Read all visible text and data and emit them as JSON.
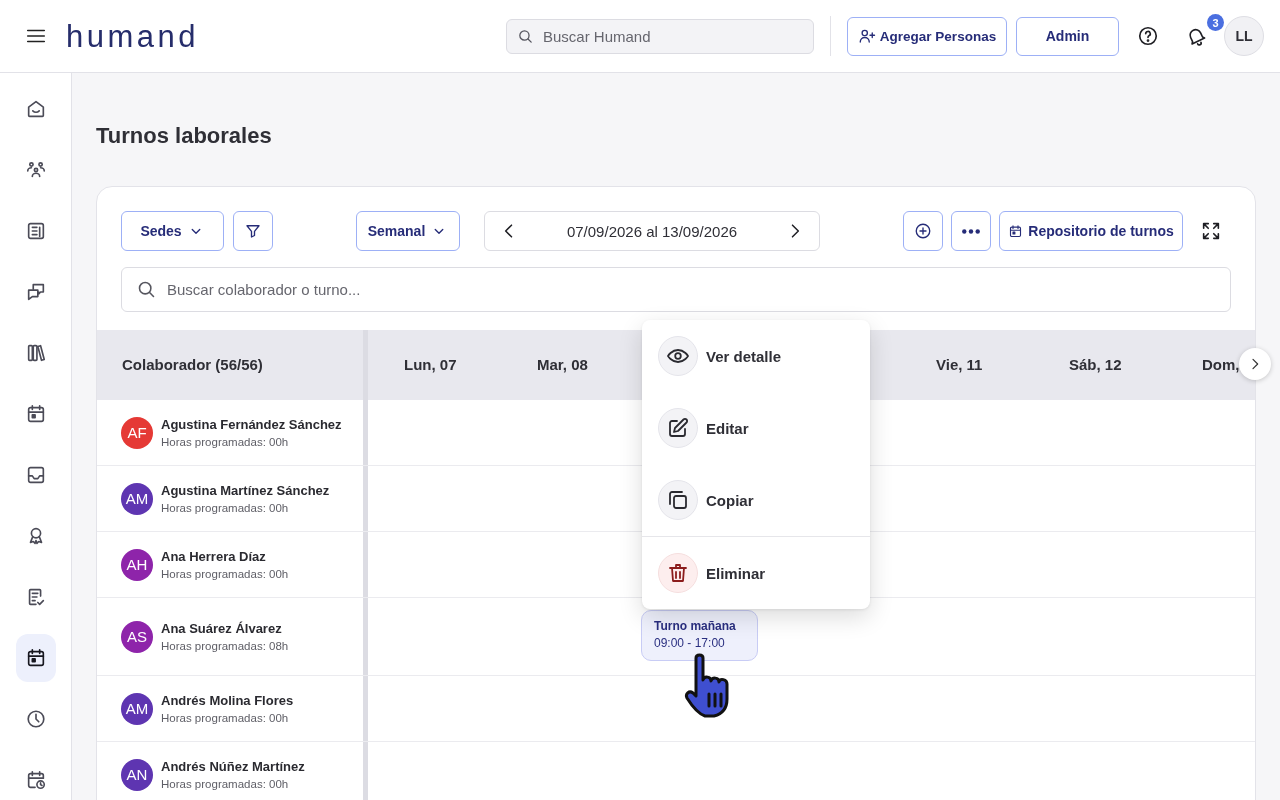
{
  "top_bar": {
    "logo": "humand",
    "search": {
      "placeholder": "Buscar Humand"
    },
    "actions": [
      {
        "kind": "add-people",
        "label": "Agregar Personas"
      },
      {
        "kind": "admin",
        "label": "Admin"
      }
    ],
    "notification_badge": "3",
    "avatar": "LL"
  },
  "sidebar": {
    "items": [
      {
        "kind": "home",
        "selected": false
      },
      {
        "kind": "people",
        "selected": false
      },
      {
        "kind": "news",
        "selected": false
      },
      {
        "kind": "chat",
        "selected": false
      },
      {
        "kind": "library",
        "selected": false
      },
      {
        "kind": "calendar",
        "selected": false
      },
      {
        "kind": "inbox",
        "selected": false
      },
      {
        "kind": "award",
        "selected": false
      },
      {
        "kind": "tasks",
        "selected": false
      },
      {
        "kind": "shifts",
        "selected": true
      },
      {
        "kind": "clock",
        "selected": false
      },
      {
        "kind": "calendar-clock",
        "selected": false
      }
    ]
  },
  "page": {
    "title": "Turnos laborales"
  },
  "toolbar": {
    "location_filter": "Sedes",
    "view": "Semanal",
    "date_range": "07/09/2026 al 13/09/2026",
    "repository": "Repositorio de turnos"
  },
  "search": {
    "placeholder": "Buscar colaborador o turno..."
  },
  "table": {
    "collaborator_header": "Colaborador (56/56)",
    "days": [
      "Lun, 07",
      "Mar, 08"
    ],
    "days_after_menu": [
      "Vie, 11",
      "Sáb, 12",
      "Dom,"
    ],
    "rows": [
      {
        "initials": "AF",
        "color": "#e53935",
        "name": "Agustina Fernández Sánchez",
        "hours": "Horas programadas: 00h"
      },
      {
        "initials": "AM",
        "color": "#5e35b1",
        "name": "Agustina Martínez Sánchez",
        "hours": "Horas programadas: 00h"
      },
      {
        "initials": "AH",
        "color": "#8e24aa",
        "name": "Ana Herrera Díaz",
        "hours": "Horas programadas: 00h"
      },
      {
        "initials": "AS",
        "color": "#8e24aa",
        "name": "Ana Suárez Álvarez",
        "hours": "Horas programadas: 08h",
        "shift": {
          "title": "Turno mañana",
          "time": "09:00 - 17:00"
        }
      },
      {
        "initials": "AM",
        "color": "#5e35b1",
        "name": "Andrés Molina Flores",
        "hours": "Horas programadas: 00h"
      },
      {
        "initials": "AN",
        "color": "#5e35b1",
        "name": "Andrés Núñez Martínez",
        "hours": "Horas programadas: 00h"
      }
    ]
  },
  "context_menu": {
    "items": [
      {
        "kind": "view",
        "label": "Ver detalle"
      },
      {
        "kind": "edit",
        "label": "Editar"
      },
      {
        "kind": "copy",
        "label": "Copiar"
      },
      {
        "kind": "delete",
        "label": "Eliminar"
      }
    ]
  }
}
